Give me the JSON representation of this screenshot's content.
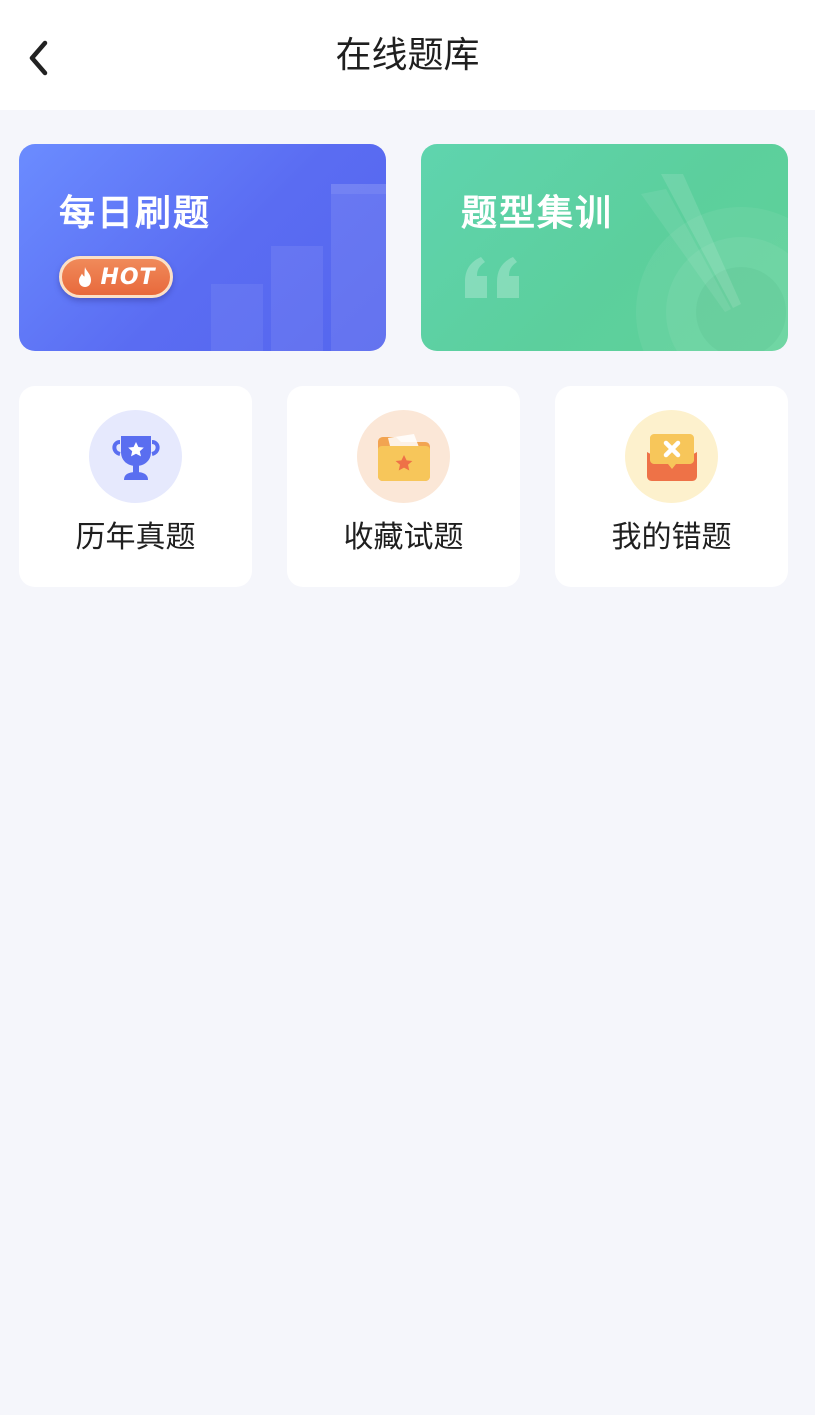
{
  "header": {
    "title": "在线题库"
  },
  "cards": {
    "daily_practice": {
      "title": "每日刷题",
      "badge": "HOT"
    },
    "type_training": {
      "title": "题型集训"
    }
  },
  "shortcuts": [
    {
      "label": "历年真题",
      "icon": "trophy-icon",
      "circle_color": "#e6e9fd"
    },
    {
      "label": "收藏试题",
      "icon": "folder-star-icon",
      "circle_color": "#fbe7d7"
    },
    {
      "label": "我的错题",
      "icon": "wrong-message-icon",
      "circle_color": "#fdf1cd"
    }
  ],
  "colors": {
    "background": "#f5f6fb",
    "daily_card": "#5a6cf2",
    "type_card": "#5ccf9d",
    "hot_badge": "#e8693c"
  }
}
